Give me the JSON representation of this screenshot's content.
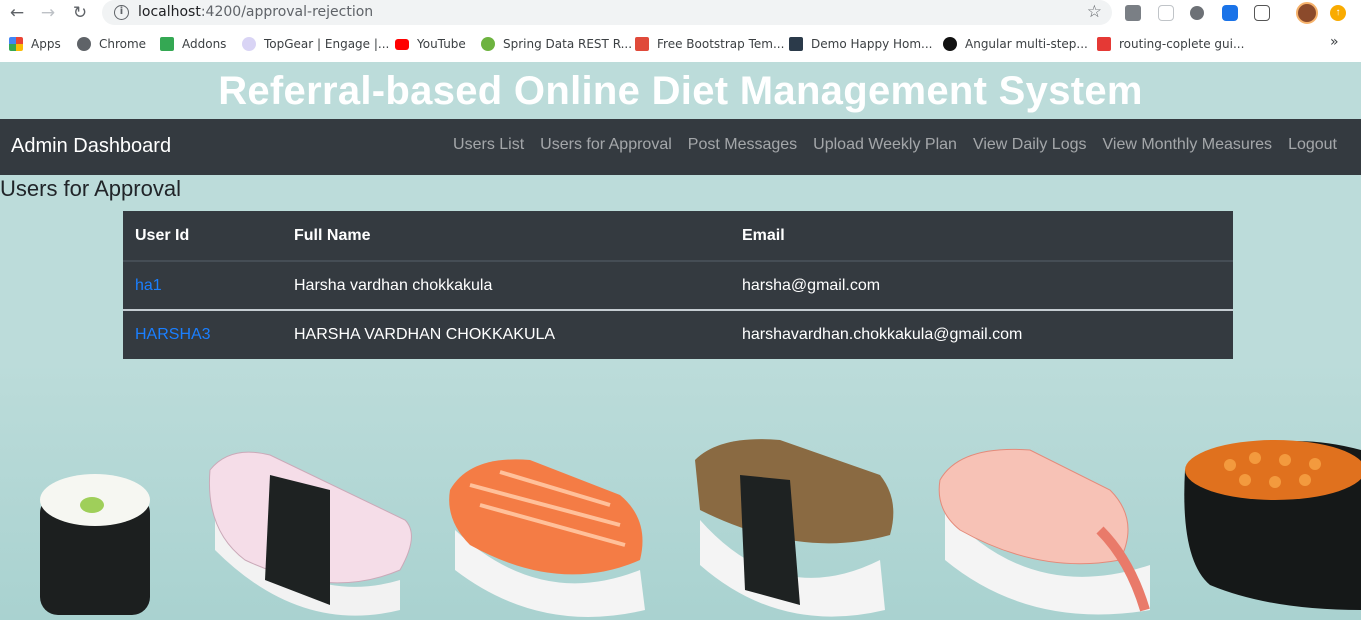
{
  "browser": {
    "url_host": "localhost",
    "url_path": ":4200/approval-rejection",
    "bookmarks": [
      {
        "label": "Apps",
        "icon": "apps-grid-icon",
        "color": "#ea4335"
      },
      {
        "label": "Chrome",
        "icon": "chrome-icon",
        "color": "#5f6368"
      },
      {
        "label": "Addons",
        "icon": "puzzle-icon",
        "color": "#34a853"
      },
      {
        "label": "TopGear | Engage |...",
        "icon": "topgear-icon",
        "color": "#7b6fd6"
      },
      {
        "label": "YouTube",
        "icon": "youtube-icon",
        "color": "#ff0000"
      },
      {
        "label": "Spring Data REST R...",
        "icon": "spring-icon",
        "color": "#6db33f"
      },
      {
        "label": "Free Bootstrap Tem...",
        "icon": "bootstrap-s-icon",
        "color": "#e04a3a"
      },
      {
        "label": "Demo Happy Hom...",
        "icon": "w3-icon",
        "color": "#2b3a4a"
      },
      {
        "label": "Angular multi-step...",
        "icon": "g-icon",
        "color": "#111111"
      },
      {
        "label": "routing-coplete gui...",
        "icon": "routing-icon",
        "color": "#e53935"
      }
    ],
    "more": "»"
  },
  "header": {
    "title": "Referral-based Online Diet Management System"
  },
  "navbar": {
    "brand": "Admin Dashboard",
    "links": [
      "Users List",
      "Users for Approval",
      "Post Messages",
      "Upload Weekly Plan",
      "View Daily Logs",
      "View Monthly Measures",
      "Logout"
    ]
  },
  "main": {
    "section_title": "Users for Approval",
    "table": {
      "headers": [
        "User Id",
        "Full Name",
        "Email"
      ],
      "rows": [
        [
          "ha1",
          "Harsha vardhan chokkakula",
          "harsha@gmail.com"
        ],
        [
          "HARSHA3",
          "HARSHA VARDHAN CHOKKAKULA",
          "harshavardhan.chokkakula@gmail.com"
        ]
      ]
    }
  },
  "colors": {
    "background": "#bcdcda",
    "navbar": "#343a40",
    "link_blue": "#1a7fff"
  }
}
